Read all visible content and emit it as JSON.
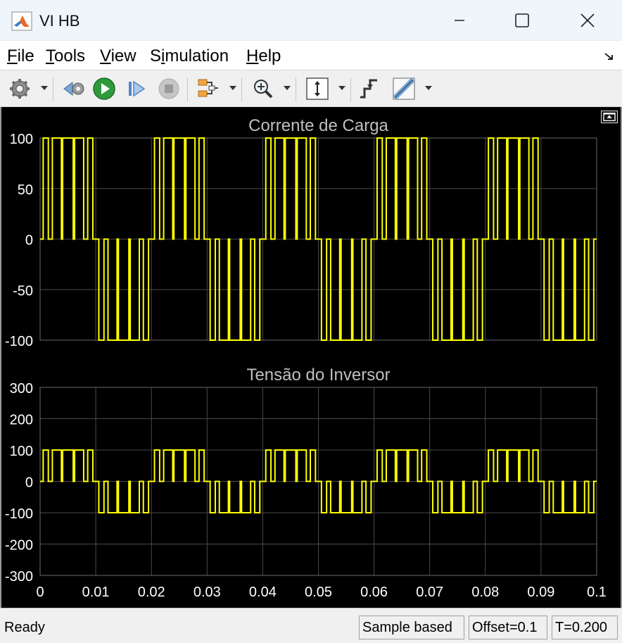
{
  "window": {
    "title": "VI HB"
  },
  "menu": {
    "items": [
      {
        "label": "File",
        "mnemonic_index": 0
      },
      {
        "label": "Tools",
        "mnemonic_index": 0
      },
      {
        "label": "View",
        "mnemonic_index": 0
      },
      {
        "label": "Simulation",
        "mnemonic_index": 1
      },
      {
        "label": "Help",
        "mnemonic_index": 0
      }
    ]
  },
  "toolbar": {
    "icons": [
      "configuration-gear-icon",
      "step-back-icon",
      "run-icon",
      "step-forward-icon",
      "stop-icon",
      "signal-selector-icon",
      "zoom-icon",
      "scale-y-axis-icon",
      "triggers-icon",
      "cursor-measurements-icon"
    ]
  },
  "colors": {
    "signal": "#ffff00",
    "axes_bg": "#000000",
    "grid": "#4a4a4a",
    "title_text": "#bfbfbf",
    "tick_text": "#ffffff"
  },
  "chart_data": [
    {
      "type": "line",
      "title": "Corrente de Carga",
      "xlim": [
        0,
        0.1
      ],
      "ylim": [
        -100,
        100
      ],
      "yticks": [
        100,
        50,
        0,
        -50,
        -100
      ],
      "grid": true,
      "signal": {
        "amplitude": 100,
        "period": 0.02,
        "carrier_pulses_per_half_cycle": 5
      }
    },
    {
      "type": "line",
      "title": "Tensão do Inversor",
      "xlim": [
        0,
        0.1
      ],
      "ylim": [
        -300,
        300
      ],
      "yticks": [
        300,
        200,
        100,
        0,
        -100,
        -200,
        -300
      ],
      "xticks": [
        0,
        0.01,
        0.02,
        0.03,
        0.04,
        0.05,
        0.06,
        0.07,
        0.08,
        0.09,
        0.1
      ],
      "xtick_labels": [
        "0",
        "0.01",
        "0.02",
        "0.03",
        "0.04",
        "0.05",
        "0.06",
        "0.07",
        "0.08",
        "0.09",
        "0.1"
      ],
      "grid": true,
      "signal": {
        "amplitude": 100,
        "period": 0.02,
        "carrier_pulses_per_half_cycle": 5
      }
    }
  ],
  "status": {
    "text": "Ready",
    "mode": "Sample based",
    "offset": "Offset=0.1",
    "time": "T=0.200"
  }
}
